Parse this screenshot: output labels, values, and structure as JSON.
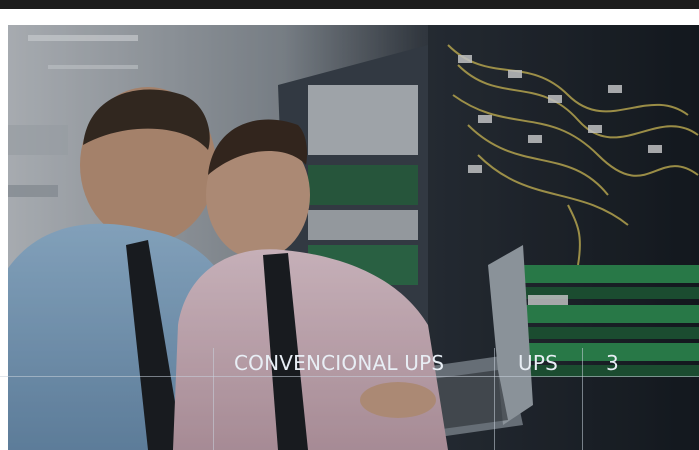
{
  "caption": {
    "title": "CONVENCIONAL UPS",
    "category": "UPS",
    "number": "3"
  },
  "photo": {
    "icon": "server-room-photo",
    "description_colors": {
      "shirt_left": "#8fb6d8",
      "shirt_right": "#e6c5cf",
      "rack": "#1f252c",
      "cable": "#d7c25a",
      "green_panel": "#3a9a5a"
    }
  }
}
